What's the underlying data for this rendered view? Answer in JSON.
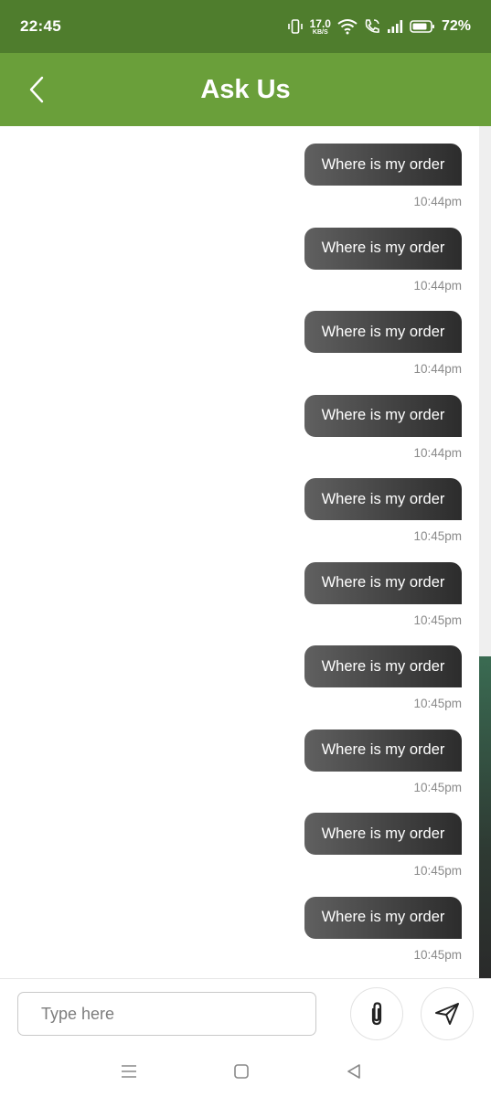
{
  "status_bar": {
    "time": "22:45",
    "net_speed_value": "17.0",
    "net_speed_unit": "KB/S",
    "battery_percent": "72%",
    "icons": [
      "vibrate-icon",
      "wifi-icon",
      "wifi-calling-icon",
      "signal-icon",
      "battery-icon"
    ]
  },
  "header": {
    "title": "Ask Us",
    "back_icon": "chevron-left-icon"
  },
  "messages": [
    {
      "text": "Where is my order",
      "time": "10:44pm"
    },
    {
      "text": "Where is my order",
      "time": "10:44pm"
    },
    {
      "text": "Where is my order",
      "time": "10:44pm"
    },
    {
      "text": "Where is my order",
      "time": "10:44pm"
    },
    {
      "text": "Where is my order",
      "time": "10:45pm"
    },
    {
      "text": "Where is my order",
      "time": "10:45pm"
    },
    {
      "text": "Where is my order",
      "time": "10:45pm"
    },
    {
      "text": "Where is my order",
      "time": "10:45pm"
    },
    {
      "text": "Where is my order",
      "time": "10:45pm"
    },
    {
      "text": "Where is my order",
      "time": "10:45pm"
    }
  ],
  "composer": {
    "placeholder": "Type here",
    "value": "",
    "attach_icon": "paperclip-icon",
    "send_icon": "send-icon"
  },
  "nav_bar": {
    "icons": [
      "menu-icon",
      "home-icon",
      "back-icon"
    ]
  },
  "colors": {
    "status_bar": "#4f7d2d",
    "app_bar": "#6a9f3a",
    "bubble_start": "#606060",
    "bubble_end": "#2c2c2c",
    "timestamp": "#8a8a8a"
  }
}
